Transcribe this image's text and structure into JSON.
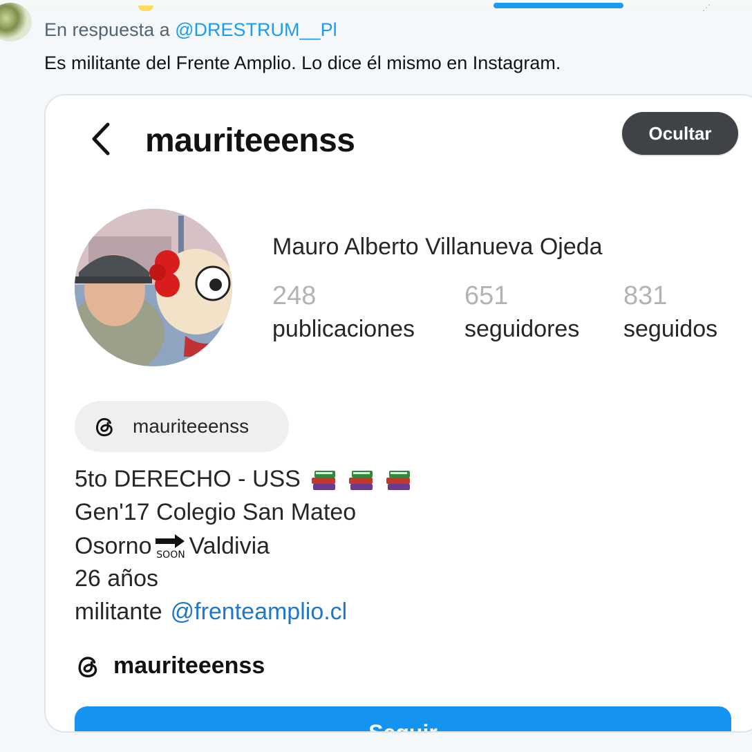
{
  "tweet": {
    "reply_prefix": "En respuesta a",
    "reply_handle": "@DRESTRUM__Pl",
    "text": "Es militante del Frente Amplio. Lo dice él mismo en Instagram."
  },
  "instagram": {
    "username": "mauriteeenss",
    "hide_label": "Ocultar",
    "display_name": "Mauro Alberto Villanueva Ojeda",
    "stats": [
      {
        "count": "248",
        "label": "publicaciones"
      },
      {
        "count": "651",
        "label": "seguidores"
      },
      {
        "count": "831",
        "label": "seguidos"
      }
    ],
    "threads_chip": "mauriteeenss",
    "bio": {
      "line1": "5to DERECHO - USS",
      "line2": "Gen'17 Colegio San Mateo",
      "line3_from": "Osorno",
      "line3_to": "Valdivia",
      "line4": "26 años",
      "line5_text": "militante",
      "line5_link": "@frenteamplio.cl"
    },
    "threads_row": "mauriteeenss",
    "follow_label": "Seguir"
  },
  "icons": [
    "back-arrow-icon",
    "threads-icon",
    "books-emoji-icon",
    "soon-arrow-emoji-icon"
  ],
  "colors": {
    "accent": "#1d9bf0",
    "ig_link": "#1f77c8",
    "follow_button": "#1493f0"
  }
}
